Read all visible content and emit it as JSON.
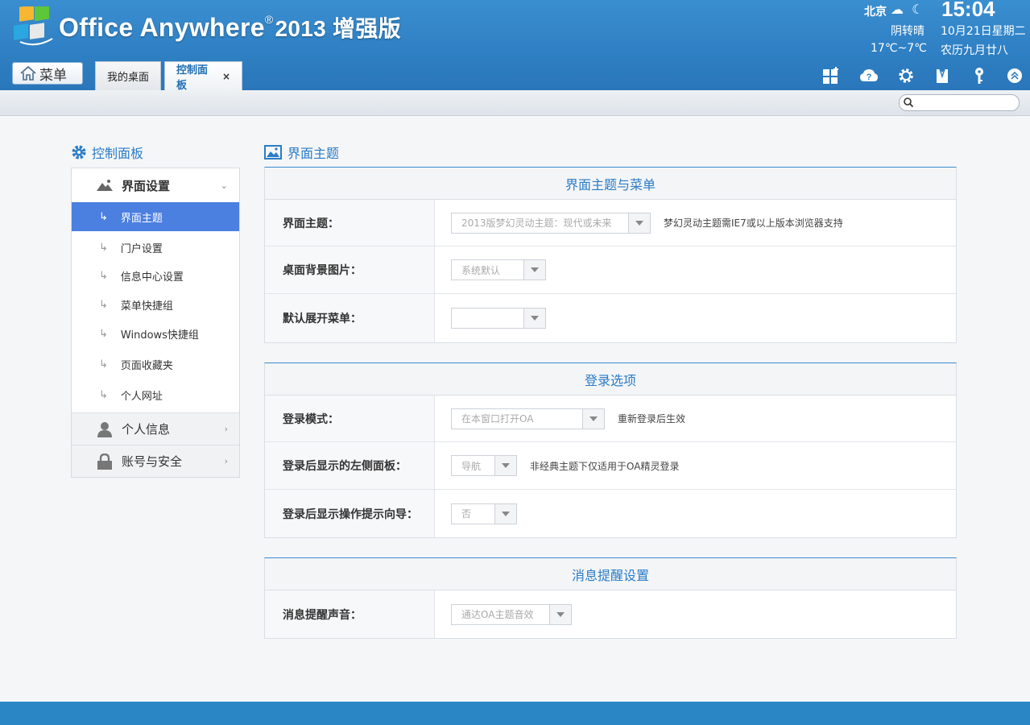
{
  "app": {
    "name": "Office Anywhere",
    "registered_mark": "®",
    "version": "2013 增强版"
  },
  "weather": {
    "city": "北京",
    "condition": "阴转晴",
    "temperature": "17℃~7℃",
    "icons": [
      "cloud-icon",
      "moon-icon"
    ]
  },
  "clock": {
    "time": "15:04",
    "date": "10月21日星期二",
    "lunar": "农历九月廿八"
  },
  "menu_button": {
    "label": "菜单"
  },
  "tabs": [
    {
      "label": "我的桌面",
      "active": false
    },
    {
      "label": "控制面板",
      "active": true,
      "close": "×"
    }
  ],
  "toolbar_icons": [
    "apps-icon",
    "help-icon",
    "settings-icon",
    "skin-icon",
    "key-icon",
    "collapse-icon"
  ],
  "search": {
    "placeholder": ""
  },
  "sidebar": {
    "title": "控制面板",
    "groups": [
      {
        "label": "界面设置",
        "expanded": true,
        "items": [
          {
            "label": "界面主题",
            "active": true
          },
          {
            "label": "门户设置"
          },
          {
            "label": "信息中心设置"
          },
          {
            "label": "菜单快捷组"
          },
          {
            "label": "Windows快捷组"
          },
          {
            "label": "页面收藏夹"
          },
          {
            "label": "个人网址"
          }
        ]
      },
      {
        "label": "个人信息",
        "expanded": false
      },
      {
        "label": "账号与安全",
        "expanded": false
      }
    ]
  },
  "main": {
    "title": "界面主题",
    "sections": [
      {
        "title": "界面主题与菜单",
        "rows": [
          {
            "label": "界面主题：",
            "value": "2013版梦幻灵动主题：现代或未来",
            "hint": "梦幻灵动主题需IE7或以上版本浏览器支持"
          },
          {
            "label": "桌面背景图片：",
            "value": "系统默认",
            "hint": ""
          },
          {
            "label": "默认展开菜单：",
            "value": "",
            "hint": ""
          }
        ]
      },
      {
        "title": "登录选项",
        "rows": [
          {
            "label": "登录模式：",
            "value": "在本窗口打开OA",
            "hint": "重新登录后生效"
          },
          {
            "label": "登录后显示的左侧面板：",
            "value": "导航",
            "hint": "非经典主题下仅适用于OA精灵登录"
          },
          {
            "label": "登录后显示操作提示向导：",
            "value": "否",
            "hint": ""
          }
        ]
      },
      {
        "title": "消息提醒设置",
        "rows": [
          {
            "label": "消息提醒声音：",
            "value": "通达OA主题音效",
            "hint": ""
          }
        ]
      }
    ]
  },
  "colors": {
    "header": "#2f80c4",
    "accent": "#2a7cc7",
    "active_nav": "#4b7fe0",
    "footer": "#2b86c6"
  }
}
